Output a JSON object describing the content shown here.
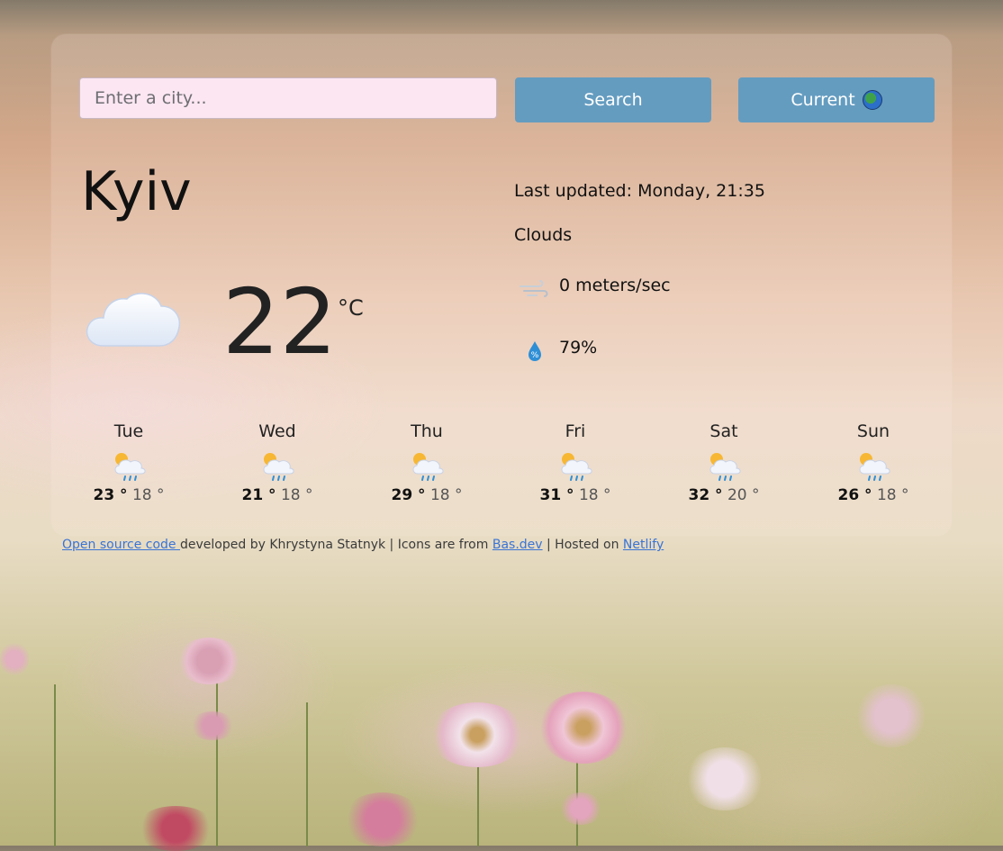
{
  "search": {
    "placeholder": "Enter a city...",
    "value": ""
  },
  "buttons": {
    "search_label": "Search",
    "current_label": "Current"
  },
  "weather": {
    "city": "Kyiv",
    "temperature": "22",
    "unit": "°C",
    "last_updated": "Last updated: Monday, 21:35",
    "description": "Clouds",
    "wind": "0 meters/sec",
    "humidity": "79%"
  },
  "forecast": [
    {
      "day": "Tue",
      "max": "23 °",
      "min": "18 °"
    },
    {
      "day": "Wed",
      "max": "21 °",
      "min": "18 °"
    },
    {
      "day": "Thu",
      "max": "29 °",
      "min": "18 °"
    },
    {
      "day": "Fri",
      "max": "31 °",
      "min": "18 °"
    },
    {
      "day": "Sat",
      "max": "32 °",
      "min": "20 °"
    },
    {
      "day": "Sun",
      "max": "26 °",
      "min": "18 °"
    }
  ],
  "footer": {
    "source_link": "Open source code ",
    "developed_text": "developed by Khrystyna Statnyk | Icons are from ",
    "icons_link": "Bas.dev",
    "hosted_text": " | Hosted on ",
    "host_link": "Netlify"
  },
  "colors": {
    "button": "#649cc0",
    "input_bg": "#fbe6f2",
    "link": "#3a74d6"
  },
  "icons": {
    "main": "cloud-icon",
    "forecast": "partly-cloudy-rain-icon",
    "wind": "wind-icon",
    "humidity": "humidity-drop-icon",
    "current": "globe-icon"
  }
}
